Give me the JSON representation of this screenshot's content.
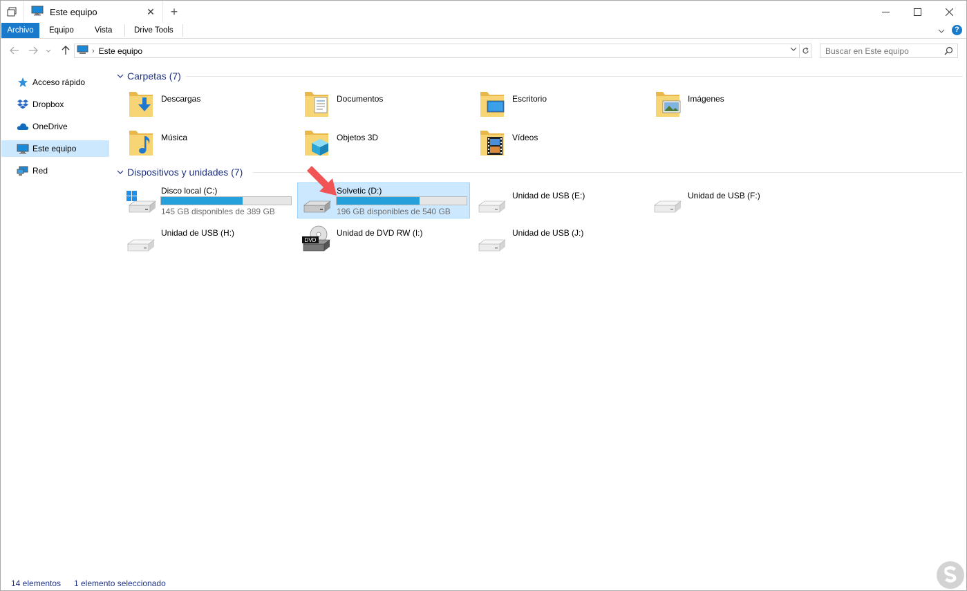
{
  "window": {
    "tab_title": "Este equipo"
  },
  "ribbon": {
    "tabs": [
      "Archivo",
      "Equipo",
      "Vista",
      "Drive Tools"
    ],
    "help": "?"
  },
  "nav": {
    "address": "Este equipo",
    "search_placeholder": "Buscar en Este equipo"
  },
  "sidebar": {
    "items": [
      {
        "label": "Acceso rápido",
        "icon": "star-icon"
      },
      {
        "label": "Dropbox",
        "icon": "dropbox-icon"
      },
      {
        "label": "OneDrive",
        "icon": "cloud-icon"
      },
      {
        "label": "Este equipo",
        "icon": "computer-icon",
        "selected": true
      },
      {
        "label": "Red",
        "icon": "network-icon"
      }
    ]
  },
  "groups": {
    "folders_title": "Carpetas (7)",
    "devices_title": "Dispositivos y unidades (7)"
  },
  "folders": [
    {
      "name": "Descargas",
      "overlay": "download-arrow"
    },
    {
      "name": "Documentos",
      "overlay": "document"
    },
    {
      "name": "Escritorio",
      "overlay": "desktop"
    },
    {
      "name": "Imágenes",
      "overlay": "picture"
    },
    {
      "name": "Música",
      "overlay": "music-note"
    },
    {
      "name": "Objetos 3D",
      "overlay": "cube"
    },
    {
      "name": "Vídeos",
      "overlay": "film"
    }
  ],
  "drives": [
    {
      "name": "Disco local (C:)",
      "free": "145 GB disponibles de 389 GB",
      "used_fraction": 0.627,
      "type": "system"
    },
    {
      "name": "Solvetic (D:)",
      "free": "196 GB disponibles de 540 GB",
      "used_fraction": 0.637,
      "type": "hdd",
      "selected": true
    },
    {
      "name": "Unidad de USB (E:)",
      "type": "usb"
    },
    {
      "name": "Unidad de USB (F:)",
      "type": "usb"
    },
    {
      "name": "Unidad de USB (H:)",
      "type": "usb"
    },
    {
      "name": "Unidad de DVD RW (I:)",
      "type": "dvd",
      "badge": "DVD"
    },
    {
      "name": "Unidad de USB (J:)",
      "type": "usb"
    }
  ],
  "status": {
    "count": "14 elementos",
    "selection": "1 elemento seleccionado"
  },
  "colors": {
    "accent": "#1979ca",
    "selection": "#cce8ff",
    "header_text": "#1e3287",
    "bar_fill": "#26a0da",
    "arrow": "#f05454"
  }
}
